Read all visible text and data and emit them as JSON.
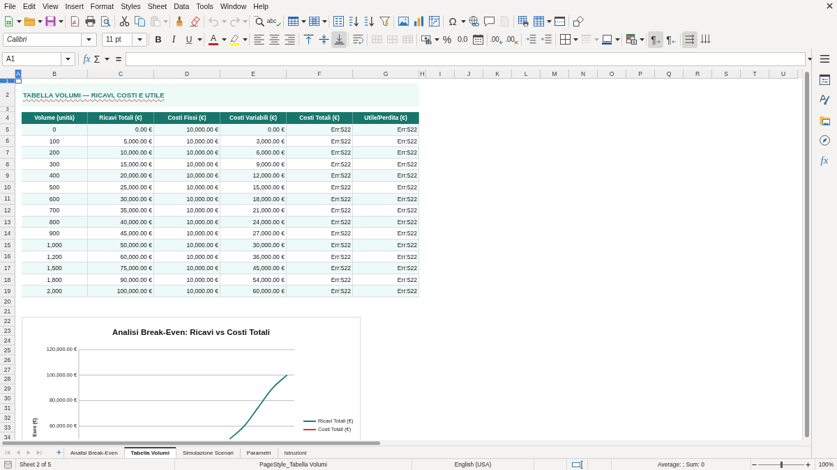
{
  "menu": [
    "File",
    "Edit",
    "View",
    "Insert",
    "Format",
    "Styles",
    "Sheet",
    "Data",
    "Tools",
    "Window",
    "Help"
  ],
  "toolbar_standard": [
    [
      {
        "kind": "new",
        "disabled": false
      },
      {
        "kind": "caret",
        "disabled": false
      },
      {
        "kind": "open",
        "disabled": false
      },
      {
        "kind": "caret",
        "disabled": false
      },
      {
        "kind": "save",
        "disabled": false
      },
      {
        "kind": "caret",
        "disabled": false
      }
    ],
    [
      {
        "kind": "pdf",
        "disabled": false
      },
      {
        "kind": "print",
        "disabled": false
      },
      {
        "kind": "preview",
        "disabled": false
      }
    ],
    [
      {
        "kind": "cut",
        "disabled": false
      },
      {
        "kind": "copy",
        "disabled": false
      },
      {
        "kind": "paste",
        "disabled": true
      },
      {
        "kind": "caret",
        "disabled": true
      }
    ],
    [
      {
        "kind": "brush",
        "disabled": false
      },
      {
        "kind": "eraser",
        "disabled": false
      }
    ],
    [
      {
        "kind": "undo",
        "disabled": true
      },
      {
        "kind": "caret",
        "disabled": true
      },
      {
        "kind": "redo",
        "disabled": true
      },
      {
        "kind": "caret",
        "disabled": true
      }
    ],
    [
      {
        "kind": "find",
        "disabled": false
      },
      {
        "kind": "spell",
        "label": "abc",
        "disabled": false
      }
    ],
    [
      {
        "kind": "rows",
        "disabled": false
      },
      {
        "kind": "caret",
        "disabled": false
      },
      {
        "kind": "columns",
        "disabled": false
      },
      {
        "kind": "caret",
        "disabled": false
      }
    ],
    [
      {
        "kind": "sort",
        "disabled": false
      },
      {
        "kind": "sortasc",
        "disabled": false
      },
      {
        "kind": "sortdesc",
        "disabled": false
      },
      {
        "kind": "filter",
        "disabled": false
      }
    ],
    [
      {
        "kind": "image",
        "disabled": false
      },
      {
        "kind": "chart",
        "disabled": false
      },
      {
        "kind": "pivot",
        "disabled": false
      }
    ],
    [
      {
        "kind": "omega",
        "label": "Ω",
        "disabled": false
      },
      {
        "kind": "caret",
        "disabled": false
      },
      {
        "kind": "link",
        "disabled": false
      },
      {
        "kind": "comment",
        "disabled": false
      },
      {
        "kind": "headerfooter",
        "disabled": true
      }
    ],
    [
      {
        "kind": "printarea",
        "disabled": false
      },
      {
        "kind": "freeze",
        "disabled": false
      },
      {
        "kind": "caret",
        "disabled": false
      },
      {
        "kind": "split",
        "disabled": false
      }
    ],
    [
      {
        "kind": "shapes",
        "disabled": false
      }
    ]
  ],
  "toolbar_formatting": {
    "font_name": "Calibri",
    "font_size": "11 pt",
    "groups": [
      [
        {
          "kind": "bold",
          "label": "B",
          "disabled": false,
          "pressed": false
        },
        {
          "kind": "italic",
          "label": "I",
          "disabled": false,
          "pressed": false
        },
        {
          "kind": "underline",
          "label": "U",
          "disabled": false,
          "pressed": false
        },
        {
          "kind": "caret",
          "disabled": false,
          "pressed": false
        }
      ],
      [
        {
          "kind": "fontcolor",
          "label": "A",
          "color": "#c9211e",
          "disabled": false,
          "pressed": false
        },
        {
          "kind": "caret",
          "disabled": false,
          "pressed": false
        },
        {
          "kind": "highlight",
          "color": "#ffff00",
          "disabled": false,
          "pressed": false
        },
        {
          "kind": "caret",
          "disabled": false,
          "pressed": false
        }
      ],
      [
        {
          "kind": "alignleft",
          "disabled": false,
          "pressed": false
        },
        {
          "kind": "aligncenter",
          "disabled": false,
          "pressed": false
        },
        {
          "kind": "alignright",
          "disabled": false,
          "pressed": false
        }
      ],
      [
        {
          "kind": "aligntop",
          "disabled": false,
          "pressed": false
        },
        {
          "kind": "alignmiddle",
          "disabled": false,
          "pressed": false
        },
        {
          "kind": "alignbottom",
          "disabled": false,
          "pressed": true
        }
      ],
      [
        {
          "kind": "wrap",
          "disabled": false,
          "pressed": false
        }
      ],
      [
        {
          "kind": "mergecenter",
          "disabled": true,
          "pressed": false
        },
        {
          "kind": "merge",
          "disabled": true,
          "pressed": false
        },
        {
          "kind": "unmerge",
          "disabled": true,
          "pressed": false
        }
      ],
      [
        {
          "kind": "currency",
          "disabled": false,
          "pressed": false
        },
        {
          "kind": "caret",
          "disabled": false,
          "pressed": false
        },
        {
          "kind": "percent",
          "label": "%",
          "disabled": false,
          "pressed": false
        },
        {
          "kind": "number",
          "label": "0.0",
          "disabled": false,
          "pressed": false
        },
        {
          "kind": "date",
          "disabled": false,
          "pressed": false
        }
      ],
      [
        {
          "kind": "adddecimal",
          "label": ".00",
          "disabled": false,
          "pressed": false
        },
        {
          "kind": "deldecimal",
          "label": ".00",
          "disabled": false,
          "pressed": false
        }
      ],
      [
        {
          "kind": "indent",
          "disabled": false,
          "pressed": false
        },
        {
          "kind": "outdent",
          "disabled": false,
          "pressed": false
        }
      ],
      [
        {
          "kind": "borders",
          "disabled": false,
          "pressed": false
        },
        {
          "kind": "caret",
          "disabled": false,
          "pressed": false
        },
        {
          "kind": "borderstyle",
          "disabled": true,
          "pressed": false
        },
        {
          "kind": "caret",
          "disabled": true,
          "pressed": false
        },
        {
          "kind": "bordercolor",
          "color": "#2a5ea8",
          "disabled": false,
          "pressed": false
        },
        {
          "kind": "caret",
          "disabled": false,
          "pressed": false
        }
      ],
      [
        {
          "kind": "conditional",
          "disabled": false,
          "pressed": false
        },
        {
          "kind": "caret",
          "disabled": false,
          "pressed": false
        }
      ],
      [
        {
          "kind": "ltr",
          "label": "¶",
          "disabled": false,
          "pressed": true
        },
        {
          "kind": "rtl",
          "label": "¶",
          "disabled": false,
          "pressed": false
        }
      ],
      [
        {
          "kind": "texthoriz",
          "disabled": false,
          "pressed": true
        },
        {
          "kind": "textvert",
          "disabled": false,
          "pressed": false
        }
      ]
    ]
  },
  "formula_bar": {
    "cell_reference": "A1",
    "buttons": [
      {
        "kind": "wizard",
        "label": "fx"
      },
      {
        "kind": "sum",
        "label": "Σ"
      },
      {
        "kind": "caret"
      },
      {
        "kind": "equals",
        "label": "="
      }
    ]
  },
  "sheet": {
    "columns": [
      {
        "label": "A",
        "selected": true
      },
      {
        "label": "B",
        "selected": false
      },
      {
        "label": "C",
        "selected": false
      },
      {
        "label": "D",
        "selected": false
      },
      {
        "label": "E",
        "selected": false
      },
      {
        "label": "F",
        "selected": false
      },
      {
        "label": "G",
        "selected": false
      },
      {
        "label": "H",
        "selected": false
      },
      {
        "label": "I",
        "selected": false
      },
      {
        "label": "J",
        "selected": false
      },
      {
        "label": "K",
        "selected": false
      },
      {
        "label": "L",
        "selected": false
      },
      {
        "label": "M",
        "selected": false
      },
      {
        "label": "N",
        "selected": false
      },
      {
        "label": "O",
        "selected": false
      },
      {
        "label": "P",
        "selected": false
      },
      {
        "label": "Q",
        "selected": false
      },
      {
        "label": "R",
        "selected": false
      },
      {
        "label": "S",
        "selected": false
      },
      {
        "label": "T",
        "selected": false
      },
      {
        "label": "U",
        "selected": false
      }
    ],
    "rows": [
      {
        "label": "1",
        "selected": true
      },
      {
        "label": "2",
        "selected": false
      },
      {
        "label": "3",
        "selected": false
      },
      {
        "label": "4",
        "selected": false
      },
      {
        "label": "5",
        "selected": false
      },
      {
        "label": "6",
        "selected": false
      },
      {
        "label": "7",
        "selected": false
      },
      {
        "label": "8",
        "selected": false
      },
      {
        "label": "9",
        "selected": false
      },
      {
        "label": "10",
        "selected": false
      },
      {
        "label": "11",
        "selected": false
      },
      {
        "label": "12",
        "selected": false
      },
      {
        "label": "13",
        "selected": false
      },
      {
        "label": "14",
        "selected": false
      },
      {
        "label": "15",
        "selected": false
      },
      {
        "label": "16",
        "selected": false
      },
      {
        "label": "17",
        "selected": false
      },
      {
        "label": "18",
        "selected": false
      },
      {
        "label": "19",
        "selected": false
      },
      {
        "label": "20",
        "selected": false
      },
      {
        "label": "21",
        "selected": false
      },
      {
        "label": "22",
        "selected": false
      },
      {
        "label": "23",
        "selected": false
      },
      {
        "label": "24",
        "selected": false
      },
      {
        "label": "25",
        "selected": false
      },
      {
        "label": "26",
        "selected": false
      },
      {
        "label": "27",
        "selected": false
      },
      {
        "label": "28",
        "selected": false
      },
      {
        "label": "29",
        "selected": false
      },
      {
        "label": "30",
        "selected": false
      },
      {
        "label": "31",
        "selected": false
      },
      {
        "label": "32",
        "selected": false
      },
      {
        "label": "33",
        "selected": false
      },
      {
        "label": "34",
        "selected": false
      }
    ],
    "title": "TABELLA VOLUMI — RICAVI, COSTI E UTILE",
    "table": {
      "columns": [
        "Volume (unità)",
        "Ricavi Totali (€)",
        "Costi Fissi (€)",
        "Costi Variabili (€)",
        "Costi Totali (€)",
        "Utile/Perdita (€)"
      ],
      "rows": [
        [
          "0",
          "0.00 €",
          "10,000.00 €",
          "0.00 €",
          "Err:522",
          "Err:522"
        ],
        [
          "100",
          "5,000.00 €",
          "10,000.00 €",
          "3,000.00 €",
          "Err:522",
          "Err:522"
        ],
        [
          "200",
          "10,000.00 €",
          "10,000.00 €",
          "6,000.00 €",
          "Err:522",
          "Err:522"
        ],
        [
          "300",
          "15,000.00 €",
          "10,000.00 €",
          "9,000.00 €",
          "Err:522",
          "Err:522"
        ],
        [
          "400",
          "20,000.00 €",
          "10,000.00 €",
          "12,000.00 €",
          "Err:522",
          "Err:522"
        ],
        [
          "500",
          "25,000.00 €",
          "10,000.00 €",
          "15,000.00 €",
          "Err:522",
          "Err:522"
        ],
        [
          "600",
          "30,000.00 €",
          "10,000.00 €",
          "18,000.00 €",
          "Err:522",
          "Err:522"
        ],
        [
          "700",
          "35,000.00 €",
          "10,000.00 €",
          "21,000.00 €",
          "Err:522",
          "Err:522"
        ],
        [
          "800",
          "40,000.00 €",
          "10,000.00 €",
          "24,000.00 €",
          "Err:522",
          "Err:522"
        ],
        [
          "900",
          "45,000.00 €",
          "10,000.00 €",
          "27,000.00 €",
          "Err:522",
          "Err:522"
        ],
        [
          "1,000",
          "50,000.00 €",
          "10,000.00 €",
          "30,000.00 €",
          "Err:522",
          "Err:522"
        ],
        [
          "1,200",
          "60,000.00 €",
          "10,000.00 €",
          "36,000.00 €",
          "Err:522",
          "Err:522"
        ],
        [
          "1,500",
          "75,000.00 €",
          "10,000.00 €",
          "45,000.00 €",
          "Err:522",
          "Err:522"
        ],
        [
          "1,800",
          "90,000.00 €",
          "10,000.00 €",
          "54,000.00 €",
          "Err:522",
          "Err:522"
        ],
        [
          "2,000",
          "100,000.00 €",
          "10,000.00 €",
          "60,000.00 €",
          "Err:522",
          "Err:522"
        ]
      ]
    },
    "chart_data": {
      "type": "line",
      "title": "Analisi Break-Even: Ricavi vs Costi Totali",
      "ylabel": "Euro (€)",
      "categories": [
        null,
        null,
        null,
        null,
        null,
        null,
        null,
        null,
        null,
        null,
        null,
        null,
        null,
        null,
        null
      ],
      "series": [
        {
          "name": "Ricavi Totali (€)",
          "color": "#1e7b70",
          "values": [
            null,
            null,
            null,
            null,
            null,
            null,
            null,
            null,
            null,
            null,
            50000,
            60000,
            75000,
            90000,
            100000
          ]
        },
        {
          "name": "Costi Totali (€)",
          "color": "#d8302f",
          "values": [
            null,
            null,
            null,
            null,
            null,
            null,
            null,
            null,
            null,
            null,
            null,
            null,
            null,
            null,
            null
          ]
        }
      ],
      "ylim": [
        50000,
        120000
      ],
      "yticks": [
        {
          "value": 60000,
          "label": "60,000.00 €"
        },
        {
          "value": 80000,
          "label": "80,000.00 €"
        },
        {
          "value": 100000,
          "label": "100,000.00 €"
        },
        {
          "value": 120000,
          "label": "120,000.00 €"
        }
      ],
      "grid": true,
      "legend": "right"
    }
  },
  "sheet_tabs": {
    "navigation": [
      {
        "kind": "first",
        "disabled": true
      },
      {
        "kind": "prev",
        "disabled": true
      },
      {
        "kind": "next",
        "disabled": true
      },
      {
        "kind": "last",
        "disabled": true
      }
    ],
    "tabs": [
      {
        "label": "Analisi Break-Even",
        "selected": false
      },
      {
        "label": "Tabella Volumi",
        "selected": true
      },
      {
        "label": "Simulazione Scenari",
        "selected": false
      },
      {
        "label": "Parametri",
        "selected": false
      },
      {
        "label": "Istruzioni",
        "selected": false
      }
    ]
  },
  "sidebar": [
    {
      "kind": "menu"
    },
    {
      "kind": "properties"
    },
    {
      "kind": "styles"
    },
    {
      "kind": "gallery"
    },
    {
      "kind": "navigator"
    },
    {
      "kind": "functions",
      "label": "fx"
    }
  ],
  "status_bar": {
    "sheet": "Sheet 2 of 5",
    "page_style": "PageStyle_Tabella Volumi",
    "language": "English (USA)",
    "selection_summary": "Average: ; Sum: 0",
    "zoom": {
      "level": 0.5,
      "reading": "100%"
    }
  }
}
